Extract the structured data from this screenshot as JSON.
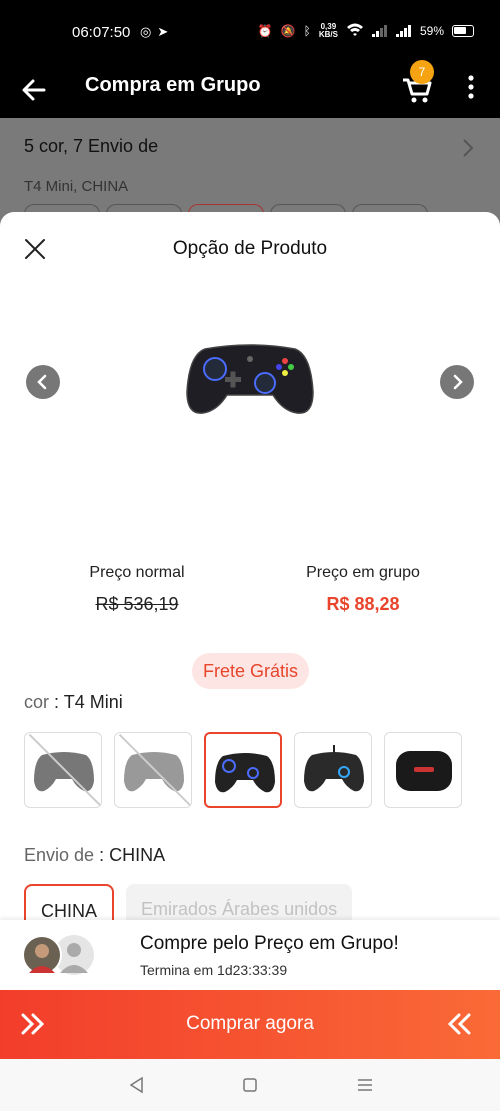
{
  "status_bar": {
    "time": "06:07:50",
    "net_speed_value": "0,39",
    "net_speed_unit": "KB/S",
    "battery": "59%"
  },
  "app_bar": {
    "title": "Compra em Grupo",
    "cart_count": "7"
  },
  "background": {
    "summary": "5 cor, 7 Envio de",
    "selected": "T4 Mini, CHINA"
  },
  "sheet": {
    "title": "Opção de Produto",
    "normal_price_label": "Preço normal",
    "normal_price": "R$ 536,19",
    "group_price_label": "Preço em grupo",
    "group_price": "R$ 88,28",
    "free_shipping": "Frete Grátis",
    "color_key": "cor",
    "color_value": "T4 Mini",
    "ship_key": "Envio de",
    "ship_value": "CHINA",
    "ship_options": [
      "CHINA",
      "Emirados Árabes unidos"
    ]
  },
  "group_bar": {
    "title": "Compre pelo Preço em Grupo!",
    "timer_label": "Termina em",
    "timer_value": "1d23:33:39"
  },
  "cta": {
    "label": "Comprar agora"
  },
  "colors": {
    "accent": "#e8452c",
    "badge": "#f6a313"
  }
}
